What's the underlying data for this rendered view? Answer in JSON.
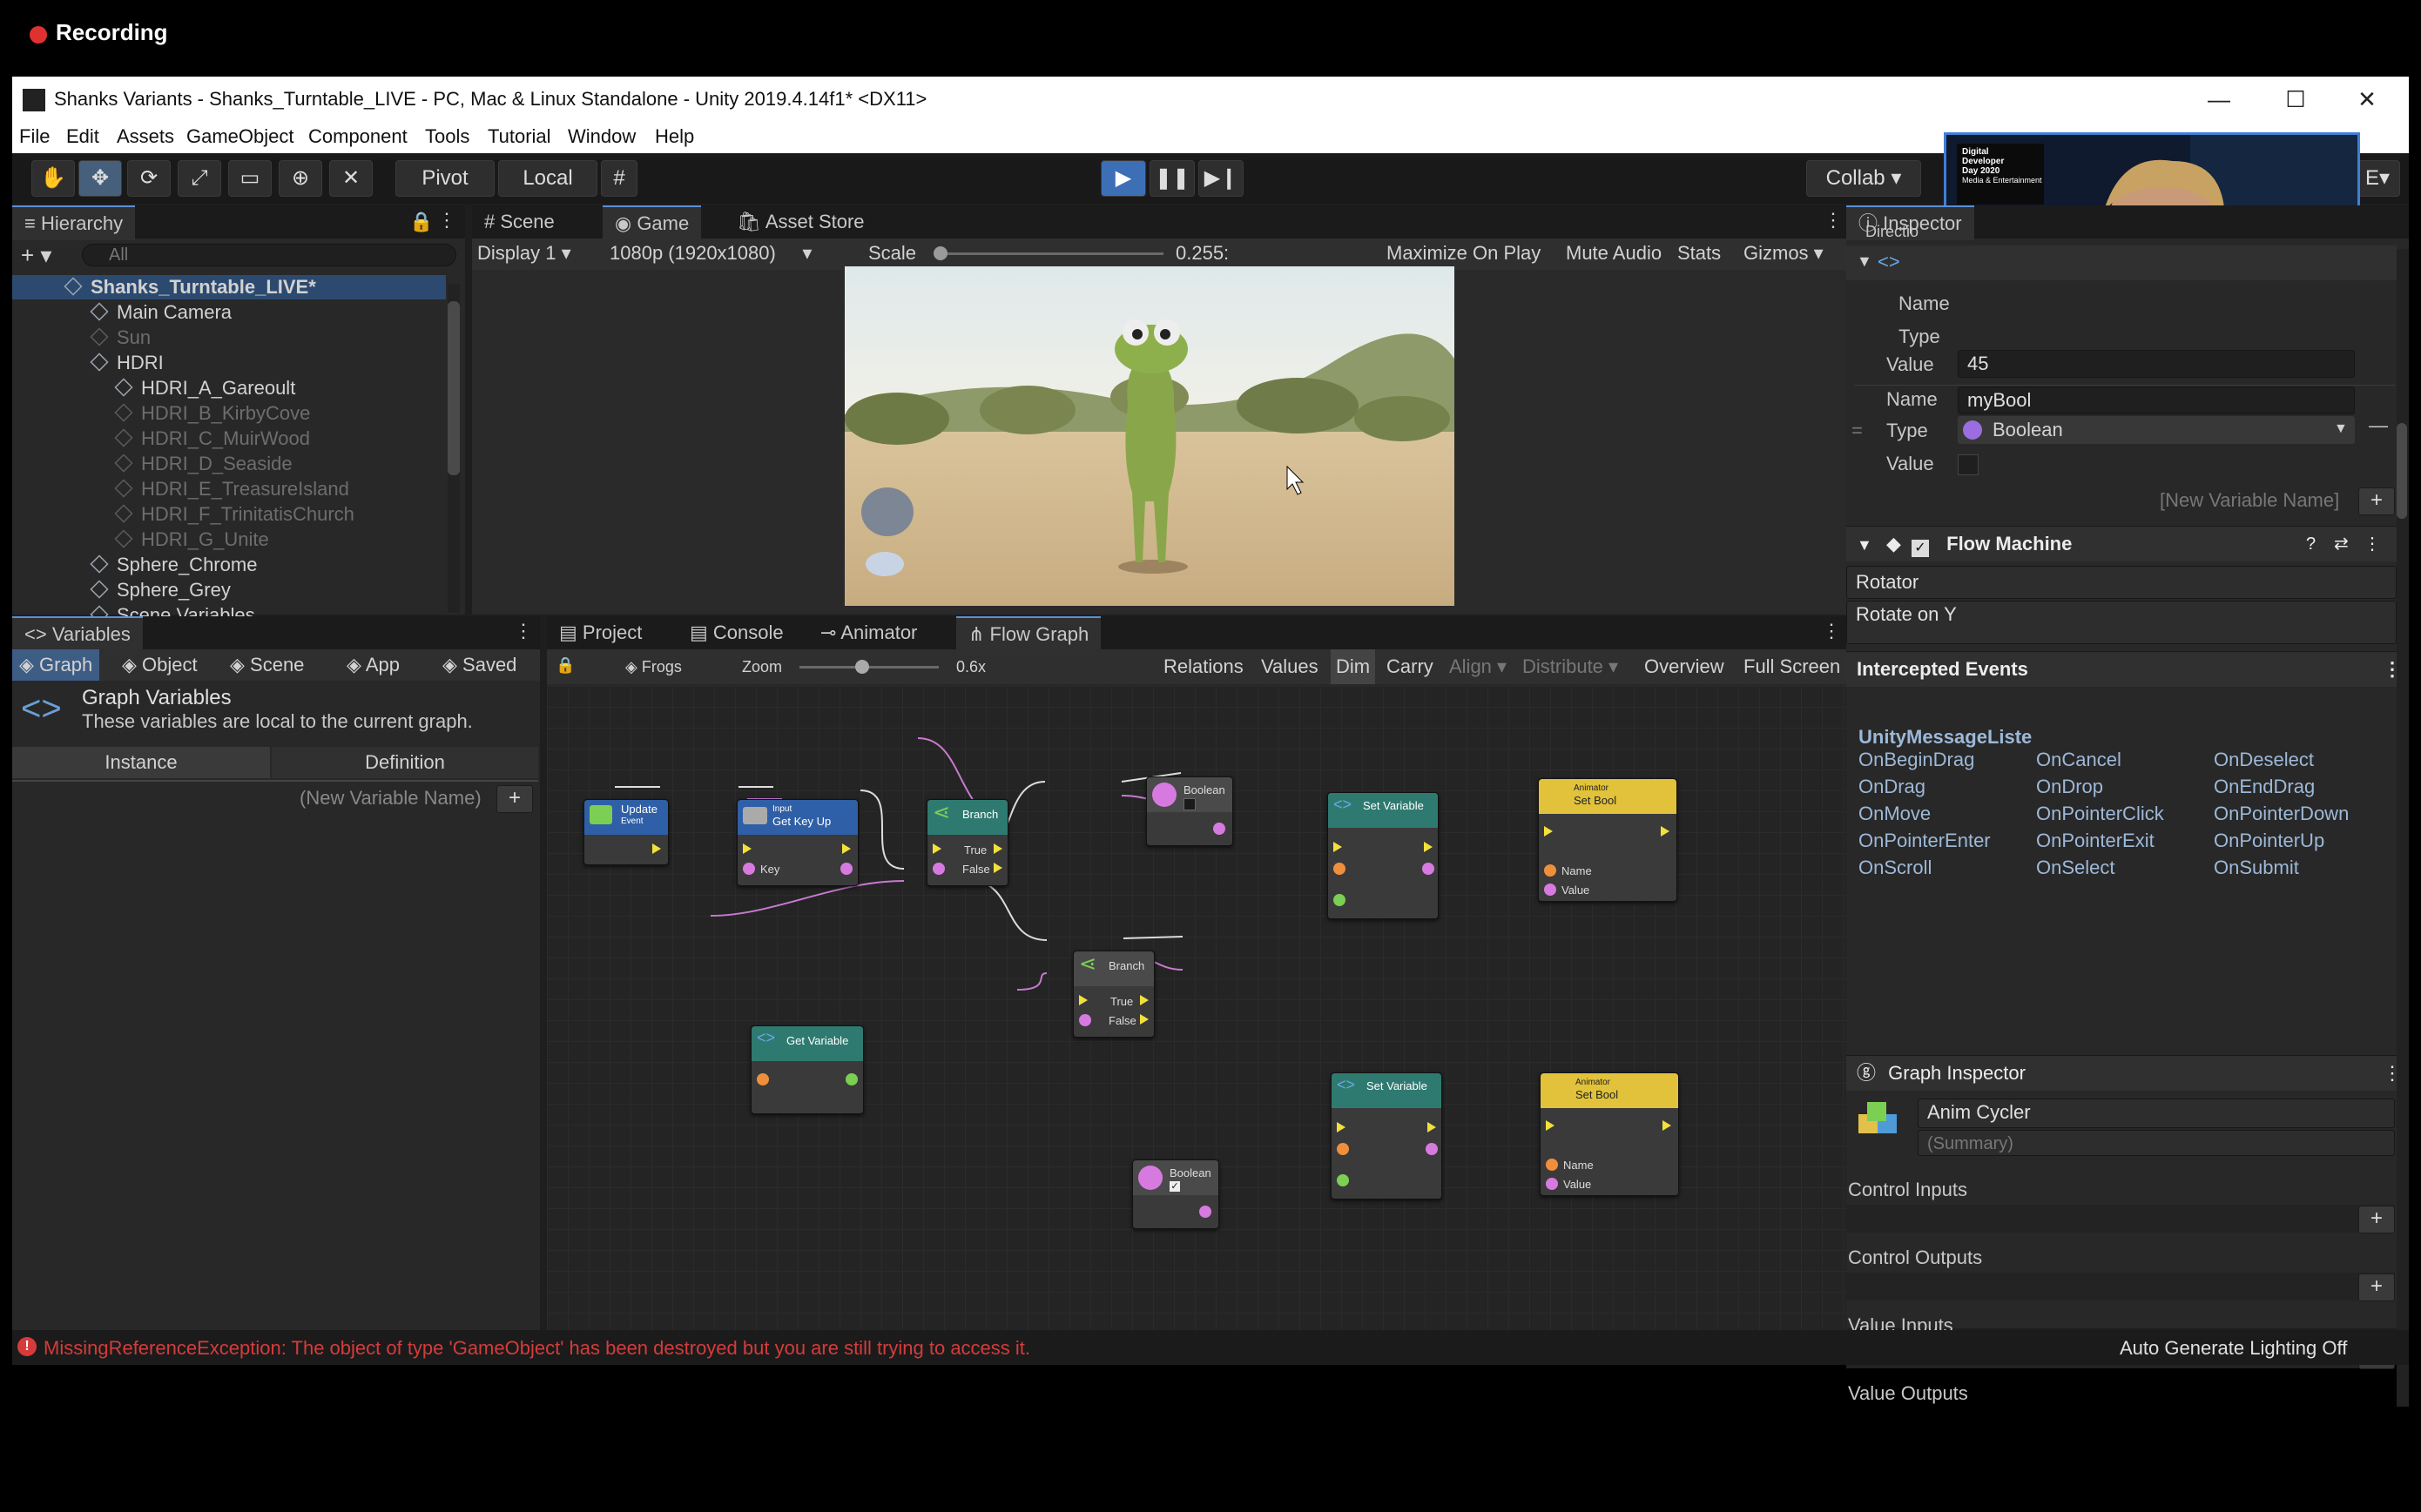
{
  "recording": {
    "label": "Recording"
  },
  "window": {
    "title": "Shanks Variants - Shanks_Turntable_LIVE - PC, Mac & Linux Standalone - Unity 2019.4.14f1* <DX11>",
    "minimize": "—",
    "maximize": "☐",
    "close": "✕"
  },
  "menu": [
    "File",
    "Edit",
    "Assets",
    "GameObject",
    "Component",
    "Tools",
    "Tutorial",
    "Window",
    "Help"
  ],
  "toolbar": {
    "pivot": "Pivot",
    "local": "Local",
    "collab": "Collab",
    "play": "▶",
    "pause": "❚❚",
    "step": "▶❙",
    "layers_suffix": "E"
  },
  "hierarchy": {
    "tab": "Hierarchy",
    "search_placeholder": "All",
    "add": "+",
    "rows": [
      {
        "label": "Shanks_Turntable_LIVE*",
        "indent": 0,
        "style": "scene"
      },
      {
        "label": "Main Camera",
        "indent": 1,
        "style": "normal"
      },
      {
        "label": "Sun",
        "indent": 1,
        "style": "gray"
      },
      {
        "label": "HDRI",
        "indent": 1,
        "style": "normal"
      },
      {
        "label": "HDRI_A_Gareoult",
        "indent": 2,
        "style": "normal"
      },
      {
        "label": "HDRI_B_KirbyCove",
        "indent": 2,
        "style": "gray"
      },
      {
        "label": "HDRI_C_MuirWood",
        "indent": 2,
        "style": "gray"
      },
      {
        "label": "HDRI_D_Seaside",
        "indent": 2,
        "style": "gray"
      },
      {
        "label": "HDRI_E_TreasureIsland",
        "indent": 2,
        "style": "gray"
      },
      {
        "label": "HDRI_F_TrinitatisChurch",
        "indent": 2,
        "style": "gray"
      },
      {
        "label": "HDRI_G_Unite",
        "indent": 2,
        "style": "gray"
      },
      {
        "label": "Sphere_Chrome",
        "indent": 1,
        "style": "normal"
      },
      {
        "label": "Sphere_Grey",
        "indent": 1,
        "style": "normal"
      },
      {
        "label": "Scene Variables",
        "indent": 1,
        "style": "normal"
      }
    ]
  },
  "scene_tabs": {
    "scene": "Scene",
    "game": "Game",
    "asset_store": "Asset Store"
  },
  "game_bar": {
    "display": "Display 1",
    "resolution": "1080p (1920x1080)",
    "scale_label": "Scale",
    "scale_value": "0.255:",
    "maximize": "Maximize On Play",
    "mute": "Mute Audio",
    "stats": "Stats",
    "gizmos": "Gizmos"
  },
  "variables": {
    "tab": "Variables",
    "scopes": [
      "Graph",
      "Object",
      "Scene",
      "App",
      "Saved"
    ],
    "title": "Graph Variables",
    "subtitle": "These variables are local to the current graph.",
    "col_instance": "Instance",
    "col_definition": "Definition",
    "new_var_placeholder": "(New Variable Name)",
    "add": "+"
  },
  "bottom_tabs": {
    "project": "Project",
    "console": "Console",
    "animator": "Animator",
    "flow_graph": "Flow Graph"
  },
  "graph_toolbar": {
    "breadcrumb": "Frogs",
    "zoom_label": "Zoom",
    "zoom_value": "0.6x",
    "relations": "Relations",
    "values": "Values",
    "dim": "Dim",
    "carry": "Carry",
    "align": "Align",
    "distribute": "Distribute",
    "overview": "Overview",
    "full_screen": "Full Screen"
  },
  "nodes": {
    "update": {
      "title": "Update",
      "sub": "Event"
    },
    "input": {
      "title": "Input",
      "sub": "Get Key Up",
      "port": "Key"
    },
    "branch1": {
      "title": "Branch",
      "true": "True",
      "false": "False"
    },
    "branch2": {
      "title": "Branch",
      "true": "True",
      "false": "False"
    },
    "boolean1": {
      "title": "Boolean"
    },
    "boolean2": {
      "title": "Boolean"
    },
    "getvar": {
      "title": "Get Variable"
    },
    "setvar1": {
      "title": "Set Variable"
    },
    "setvar2": {
      "title": "Set Variable"
    },
    "anim1": {
      "title": "Animator",
      "sub": "Set Bool",
      "name": "Name",
      "value": "Value"
    },
    "anim2": {
      "title": "Animator",
      "sub": "Set Bool",
      "name": "Name",
      "value": "Value"
    }
  },
  "inspector": {
    "tab": "Inspector",
    "direction_label": "Directio",
    "var1": {
      "name_label": "Name",
      "type_label": "Type",
      "value_label": "Value",
      "value": "45"
    },
    "var2": {
      "name_label": "Name",
      "name": "myBool",
      "type_label": "Type",
      "type": "Boolean",
      "value_label": "Value"
    },
    "new_var_placeholder": "[New Variable Name]",
    "flow_machine": "Flow Machine",
    "machine_title": "Rotator",
    "machine_summary": "Rotate on Y",
    "intercepted": "Intercepted Events",
    "listener": "UnityMessageListe",
    "events": [
      [
        "OnBeginDrag",
        "OnCancel",
        "OnDeselect"
      ],
      [
        "OnDrag",
        "OnDrop",
        "OnEndDrag"
      ],
      [
        "OnMove",
        "OnPointerClick",
        "OnPointerDown"
      ],
      [
        "OnPointerEnter",
        "OnPointerExit",
        "OnPointerUp"
      ],
      [
        "OnScroll",
        "OnSelect",
        "OnSubmit"
      ]
    ],
    "graph_inspector": "Graph Inspector",
    "graph_title": "Anim Cycler",
    "graph_summary": "(Summary)",
    "control_inputs": "Control Inputs",
    "control_outputs": "Control Outputs",
    "value_inputs": "Value Inputs",
    "value_outputs": "Value Outputs",
    "add": "+"
  },
  "webcam": {
    "banner_line1": "Digital",
    "banner_line2": "Developer",
    "banner_line3": "Day 2020",
    "banner_line4": "Media & Entertainment"
  },
  "status": {
    "error": "MissingReferenceException: The object of type 'GameObject' has been destroyed but you are still trying to access it.",
    "lighting": "Auto Generate Lighting Off"
  },
  "colors": {
    "accent": "#3d6fb6",
    "error": "#d63b3b",
    "port_pink": "#d77ae0",
    "port_orange": "#f08f3b",
    "port_green": "#7bcf52",
    "animator_yellow": "#e1c23a"
  }
}
